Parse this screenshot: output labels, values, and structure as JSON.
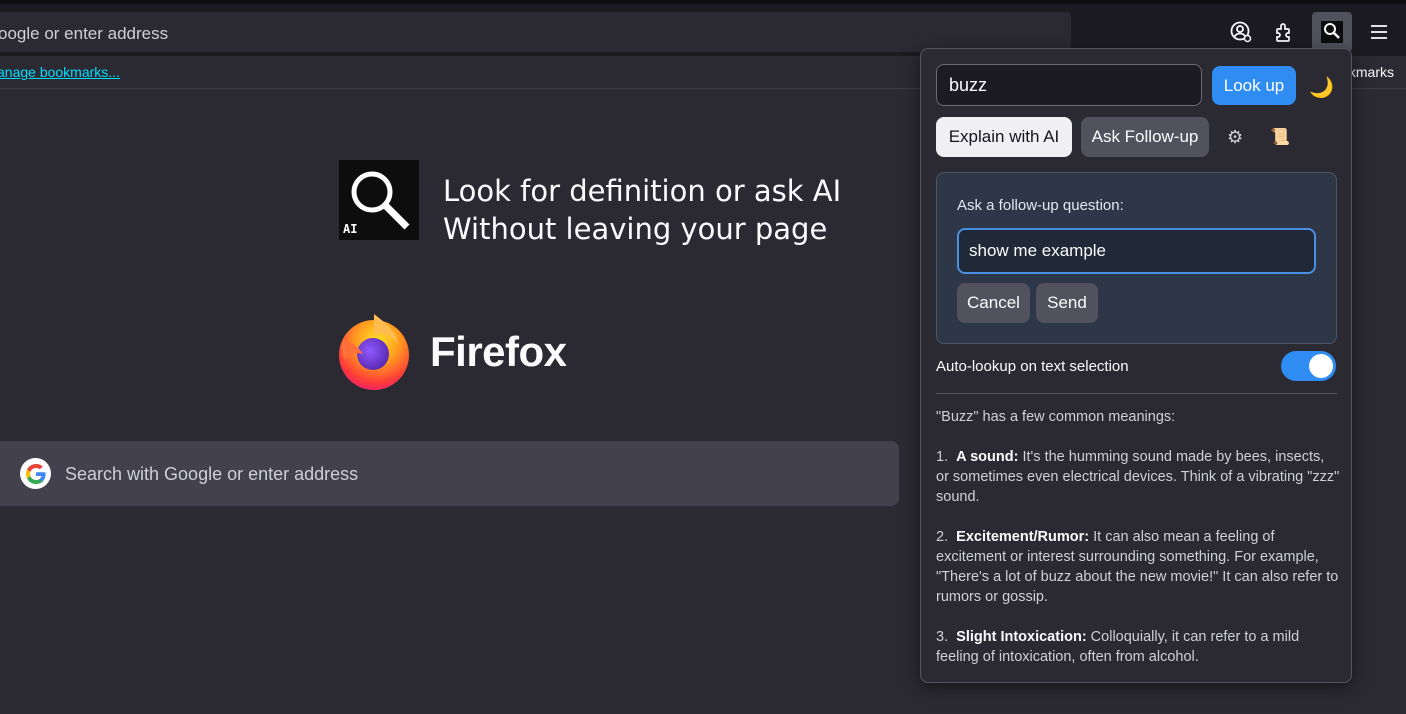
{
  "toolbar": {
    "url_placeholder": "oogle or enter address",
    "icons": [
      "account-icon",
      "extensions-icon",
      "lookup-extension-icon",
      "menu-icon"
    ]
  },
  "bookmarks": {
    "manage_link": "anage bookmarks...",
    "right_label": "kmarks"
  },
  "newtab": {
    "promo_line1": "Look for definition or ask AI",
    "promo_line2": "Without leaving your page",
    "promo_logo_badge": "AI",
    "brand": "Firefox",
    "search_placeholder": "Search with Google or enter address"
  },
  "popup": {
    "word_value": "buzz",
    "lookup_label": "Look up",
    "explain_label": "Explain with AI",
    "followup_label": "Ask Follow-up",
    "followup_panel": {
      "question_label": "Ask a follow-up question:",
      "question_value": "show me example",
      "cancel_label": "Cancel",
      "send_label": "Send"
    },
    "auto_lookup_label": "Auto-lookup on text selection",
    "auto_lookup_enabled": true,
    "result": {
      "intro": "\"Buzz\" has a few common meanings:",
      "items": [
        {
          "num": "1.",
          "term": "A sound:",
          "text": " It's the humming sound made by bees, insects, or sometimes even electrical devices. Think of a vibrating \"zzz\" sound."
        },
        {
          "num": "2.",
          "term": "Excitement/Rumor:",
          "text": " It can also mean a feeling of excitement or interest surrounding something. For example, \"There's a lot of buzz about the new movie!\" It can also refer to rumors or gossip."
        },
        {
          "num": "3.",
          "term": "Slight Intoxication:",
          "text": " Colloquially, it can refer to a mild feeling of intoxication, often from alcohol."
        }
      ]
    }
  },
  "colors": {
    "accent": "#2f8cf3",
    "link": "#00ddff",
    "background": "#2b2a33"
  }
}
